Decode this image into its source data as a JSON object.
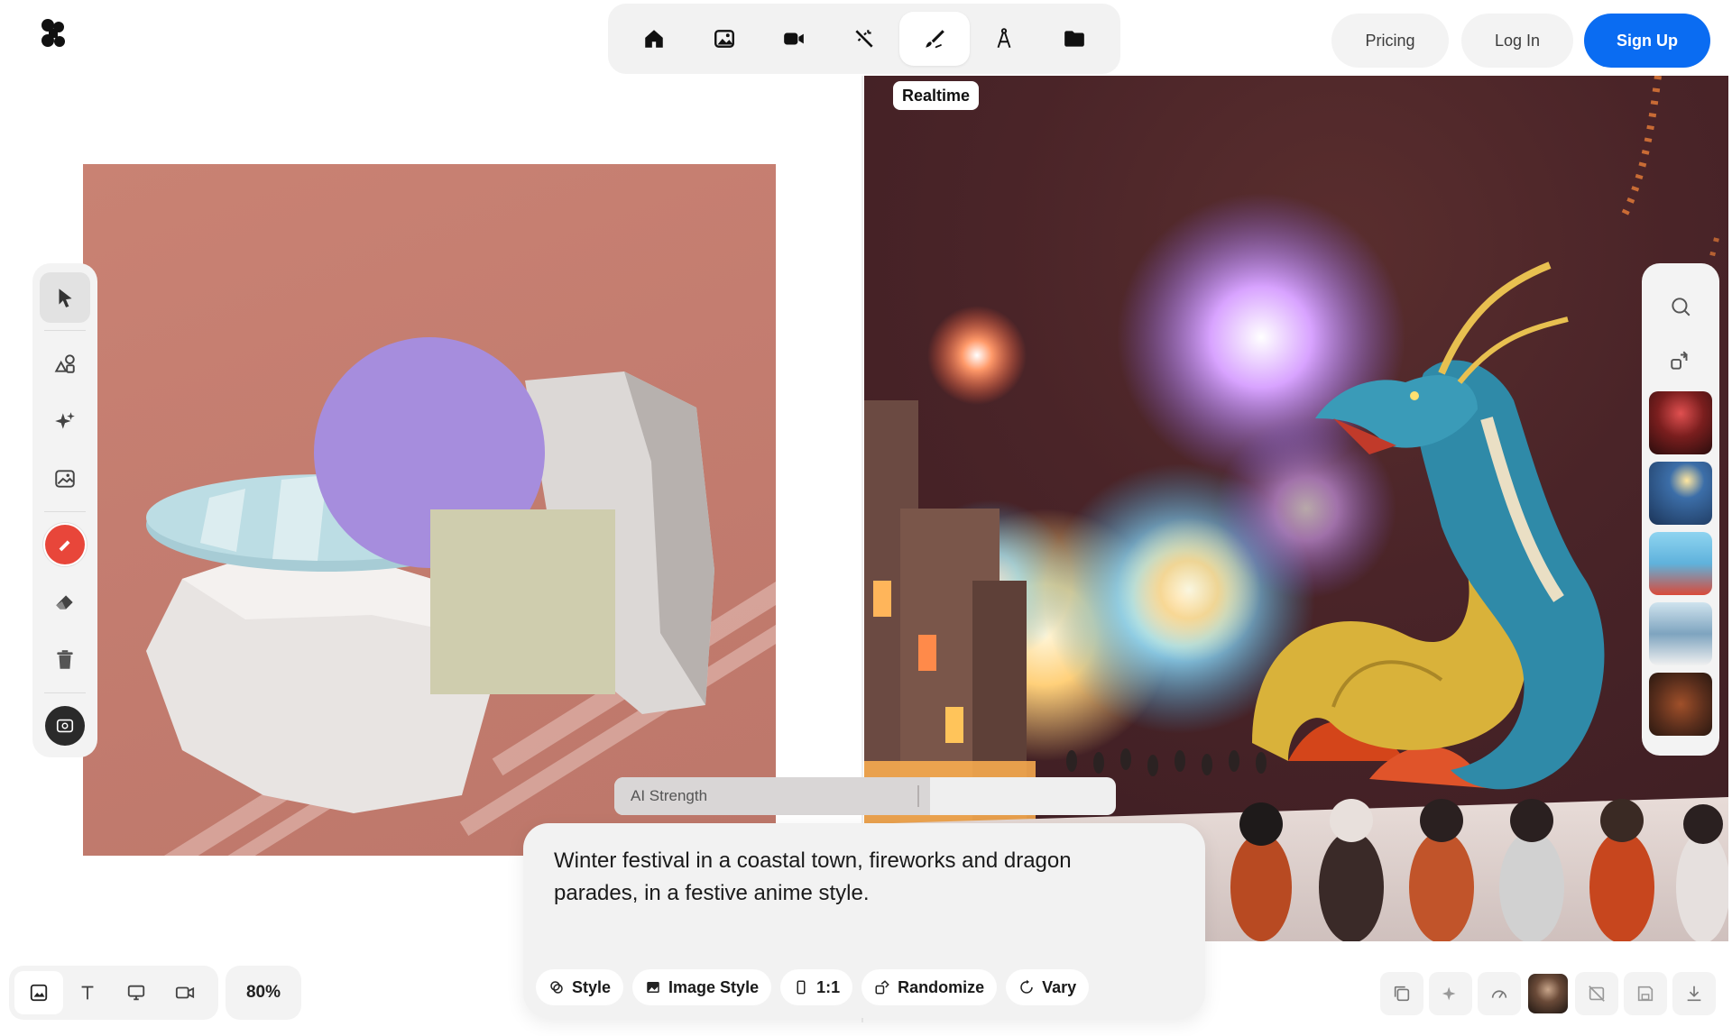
{
  "header": {
    "pricing_label": "Pricing",
    "login_label": "Log In",
    "signup_label": "Sign Up",
    "accent": "#0a6cf2"
  },
  "topnav": {
    "items": [
      {
        "icon": "home-icon"
      },
      {
        "icon": "image-icon"
      },
      {
        "icon": "video-camera-icon"
      },
      {
        "icon": "magic-wand-icon"
      },
      {
        "icon": "brush-pen-icon",
        "active": true
      },
      {
        "icon": "compass-draw-icon"
      },
      {
        "icon": "folder-icon"
      }
    ]
  },
  "canvas": {
    "realtime_label": "Realtime"
  },
  "left_tools": {
    "items": [
      "cursor-arrow-icon",
      "shapes-icon",
      "sparkle-icon",
      "image-icon",
      "brush-color-icon",
      "eraser-icon",
      "trash-icon",
      "background-icon"
    ],
    "brush_color": "#e8463a"
  },
  "right_tools": {
    "icons": [
      "search-icon",
      "swap-icon"
    ],
    "thumbnails": [
      "thumbnail-1",
      "thumbnail-2",
      "thumbnail-3",
      "thumbnail-4",
      "thumbnail-5"
    ]
  },
  "ai_strength": {
    "label": "AI Strength",
    "value": 0.63
  },
  "prompt": {
    "text": "Winter festival in a coastal town, fireworks and dragon parades, in a festive anime style.",
    "chips": {
      "style": "Style",
      "image_style": "Image Style",
      "ratio": "1:1",
      "randomize": "Randomize",
      "vary": "Vary"
    }
  },
  "bottom_left": {
    "zoom": "80%",
    "items": [
      "image-mode-icon",
      "text-icon",
      "screen-icon",
      "video-mode-icon"
    ]
  },
  "bottom_right": {
    "items": [
      "copy-layers-icon",
      "sparkle-enhance-icon",
      "speed-gauge-icon",
      "avatar",
      "no-image-icon",
      "save-icon",
      "download-icon"
    ]
  }
}
